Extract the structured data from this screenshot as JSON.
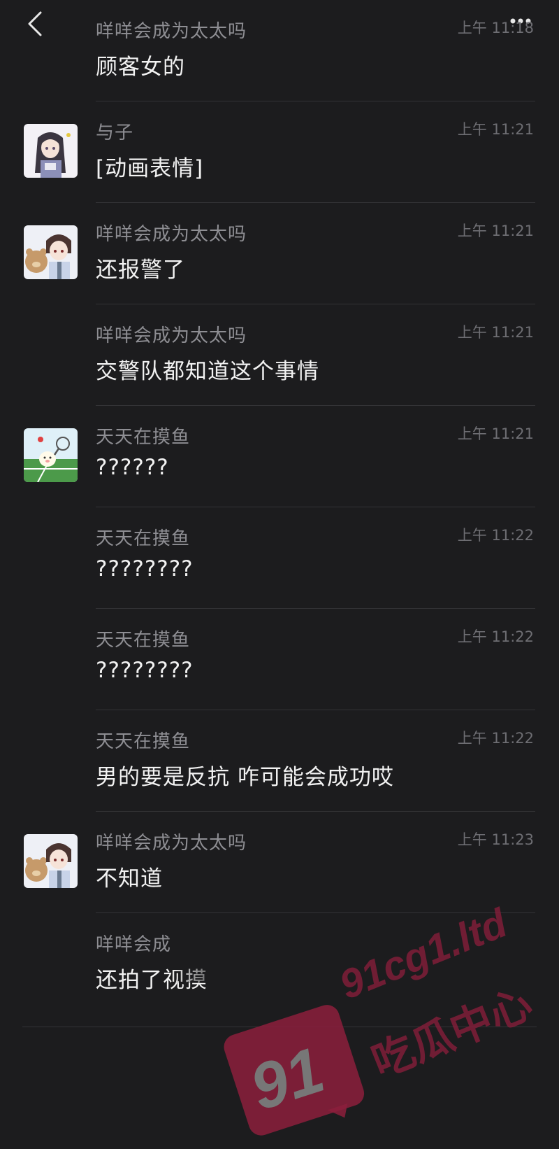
{
  "header": {
    "back_icon": "chevron-left-icon",
    "more_icon": "ellipsis-icon"
  },
  "messages": [
    {
      "sender": "咩咩会成为太太吗",
      "time": "上午 11:18",
      "text": "顾客女的",
      "avatar": "none"
    },
    {
      "sender": "与子",
      "time": "上午 11:21",
      "text": "[动画表情]",
      "avatar": "anime-girl-avatar"
    },
    {
      "sender": "咩咩会成为太太吗",
      "time": "上午 11:21",
      "text": "还报警了",
      "avatar": "anime-boy-bear-avatar"
    },
    {
      "sender": "咩咩会成为太太吗",
      "time": "上午 11:21",
      "text": "交警队都知道这个事情",
      "avatar": "none"
    },
    {
      "sender": "天天在摸鱼",
      "time": "上午 11:21",
      "text": "??????",
      "avatar": "tennis-cartoon-avatar"
    },
    {
      "sender": "天天在摸鱼",
      "time": "上午 11:22",
      "text": "????????",
      "avatar": "none"
    },
    {
      "sender": "天天在摸鱼",
      "time": "上午 11:22",
      "text": "????????",
      "avatar": "none"
    },
    {
      "sender": "天天在摸鱼",
      "time": "上午 11:22",
      "text": "男的要是反抗  咋可能会成功哎",
      "avatar": "none"
    },
    {
      "sender": "咩咩会成为太太吗",
      "time": "上午 11:23",
      "text": "不知道",
      "avatar": "anime-boy-bear-avatar"
    },
    {
      "sender": "咩咩会成",
      "time": "",
      "text": "还拍了视摸",
      "avatar": "none"
    }
  ],
  "watermark": {
    "line1": "91cg1.ltd",
    "line2": "吃瓜中心",
    "badge": "91",
    "color": "#8c1e3c"
  }
}
